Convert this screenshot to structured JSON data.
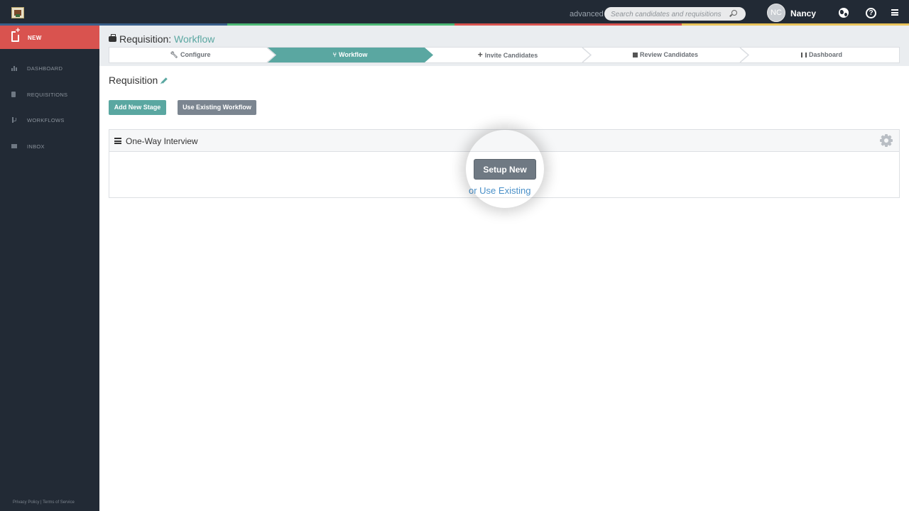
{
  "topbar": {
    "mode_label": "advanced",
    "search_placeholder": "Search candidates and requisitions",
    "user_initials": "NC",
    "user_name": "Nancy",
    "help_glyph": "?"
  },
  "colors": {
    "accent": "#5aa7a1",
    "new_button": "#d9534f",
    "sidebar": "#222a35",
    "stripe": [
      "#3a5f8a",
      "#4cb874",
      "#d9534f",
      "#e8c35a"
    ]
  },
  "sidebar": {
    "new_label": "NEW",
    "items": [
      {
        "label": "DASHBOARD",
        "icon": "bar-chart-icon"
      },
      {
        "label": "REQUISITIONS",
        "icon": "document-icon"
      },
      {
        "label": "WORKFLOWS",
        "icon": "branch-icon"
      },
      {
        "label": "INBOX",
        "icon": "mail-icon"
      }
    ],
    "footer": "Privacy Policy | Terms of Service"
  },
  "header": {
    "title_prefix": "Requisition:",
    "title_accent": "Workflow",
    "steps": [
      {
        "label": "Configure",
        "icon": "wrench-icon",
        "active": false
      },
      {
        "label": "Workflow",
        "icon": "branch-icon",
        "active": true
      },
      {
        "label": "Invite Candidates",
        "icon": "plus-icon",
        "active": false
      },
      {
        "label": "Review Candidates",
        "icon": "id-card-icon",
        "active": false
      },
      {
        "label": "Dashboard",
        "icon": "bar-chart-icon",
        "active": false
      }
    ]
  },
  "main": {
    "requisition_title": "Requisition",
    "add_stage_label": "Add New Stage",
    "use_workflow_label": "Use Existing Workflow",
    "stage": {
      "title": "One-Way Interview",
      "setup_label": "Setup New",
      "use_existing_label": "or Use Existing"
    }
  }
}
